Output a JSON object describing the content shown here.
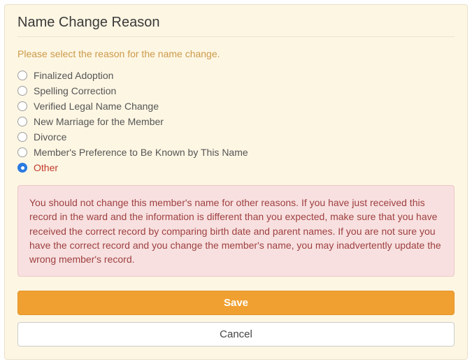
{
  "panel": {
    "title": "Name Change Reason",
    "instruction": "Please select the reason for the name change."
  },
  "options": [
    {
      "label": "Finalized Adoption",
      "selected": false
    },
    {
      "label": "Spelling Correction",
      "selected": false
    },
    {
      "label": "Verified Legal Name Change",
      "selected": false
    },
    {
      "label": "New Marriage for the Member",
      "selected": false
    },
    {
      "label": "Divorce",
      "selected": false
    },
    {
      "label": "Member's Preference to Be Known by This Name",
      "selected": false
    },
    {
      "label": "Other",
      "selected": true
    }
  ],
  "alert": {
    "text": "You should not change this member's name for other reasons. If you have just received this record in the ward and the information is different than you expected, make sure that you have received the correct record by comparing birth date and parent names. If you are not sure you have the correct record and you change the member's name, you may inadvertently update the wrong member's record."
  },
  "buttons": {
    "save": "Save",
    "cancel": "Cancel"
  }
}
